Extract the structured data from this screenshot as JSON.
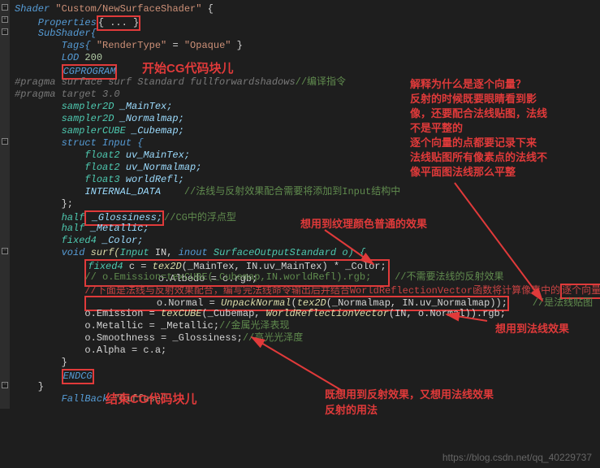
{
  "code": {
    "l0": "Shader \"Custom/NewSurfaceShader\" {",
    "l1_a": "    Properties",
    "l1_b": "{ ... }",
    "l2": "    SubShader{",
    "l3_a": "        Tags{ ",
    "l3_b": "\"RenderType\"",
    "l3_c": " = ",
    "l3_d": "\"Opaque\"",
    "l3_e": " }",
    "l4": "        LOD 200",
    "l5": "        CGPROGRAM",
    "l6": "#pragma surface surf Standard fullforwardshadows",
    "l6_cmt": "//编译指令",
    "l7": "#pragma target 3.0",
    "l8_t": "        sampler2D",
    "l8_v": " _MainTex;",
    "l9_t": "        sampler2D",
    "l9_v": " _Normalmap;",
    "l10_t": "        samplerCUBE",
    "l10_v": " _Cubemap;",
    "l11": "        struct Input {",
    "l12_t": "            float2",
    "l12_v": " uv_MainTex;",
    "l13_t": "            float2",
    "l13_v": " uv_Normalmap;",
    "l14_t": "            float3",
    "l14_v": " worldRefl;",
    "l15": "            INTERNAL_DATA",
    "l15_cmt": "    //法线与反射效果配合需要将添加到Input结构中",
    "l16": "        };",
    "l17_a": "        half",
    "l17_b": " _Glossiness;",
    "l17_cmt": "//CG中的浮点型",
    "l18_a": "        half",
    "l18_b": " _Metallic;",
    "l19_a": "        fixed4",
    "l19_b": " _Color;",
    "l20_a": "        void",
    "l20_b": " surf(",
    "l20_c": "Input",
    "l20_d": " IN, ",
    "l20_e": "inout",
    "l20_f": " SurfaceOutputStandard o) {",
    "l21_a": "            fixed4",
    "l21_b": " c = ",
    "l21_c": "tex2D",
    "l21_d": "(_MainTex, IN.uv_MainTex) * _Color;",
    "l22": "            o.Albedo = c.rgb;",
    "l23_a": "            // o.Emission=texCUBE(_Cubemap,IN.worldRefl).rgb;",
    "l23_b": "    //不需要法线的反射效果",
    "l24_a": "            //下面是法线与反射效果配合，编写完法线命令输出后并结合",
    "l24_b": "WorldReflectionVector",
    "l24_c": "函数将计算像素中的",
    "l24_d": "逐个向量",
    "l25_a": "            o.Normal = ",
    "l25_b": "UnpackNormal",
    "l25_c": "(",
    "l25_d": "tex2D",
    "l25_e": "(_Normalmap, IN.uv_Normalmap));",
    "l25_cmt": "    //是法线贴图",
    "l26_a": "            o.Emission = ",
    "l26_b": "texCUBE",
    "l26_c": "(_Cubemap, ",
    "l26_d": "WorldReflectionVector",
    "l26_e": "(IN, o.Normal)).rgb;",
    "l27": "            o.Metallic = _Metallic;",
    "l27_cmt": "//金属光泽表现",
    "l28": "            o.Smoothness = _Glossiness;",
    "l28_cmt": "//高光光泽度",
    "l29": "            o.Alpha = c.a;",
    "l30": "        }",
    "l31": "        ENDCG",
    "l32": "    }",
    "l33_a": "        FallBack ",
    "l33_b": "\"Diffuse\""
  },
  "annotations": {
    "start_cg": "开始CG代码块儿",
    "end_cg": "结束CG代码块儿",
    "tex_effect": "想用到纹理颜色普通的效果",
    "normal_effect": "想用到法线效果",
    "reflect_normal": "既想用到反射效果，又想用法线效果\n反射的用法",
    "why_vector": "解释为什么是逐个向量？\n反射的时候既要眼睛看到影\n像，还要配合法线贴图，法线\n不是平整的\n逐个向量的点都要记录下来\n法线贴图所有像素点的法线不\n像平面图法线那么平整"
  },
  "watermark": "https://blog.csdn.net/qq_40229737"
}
